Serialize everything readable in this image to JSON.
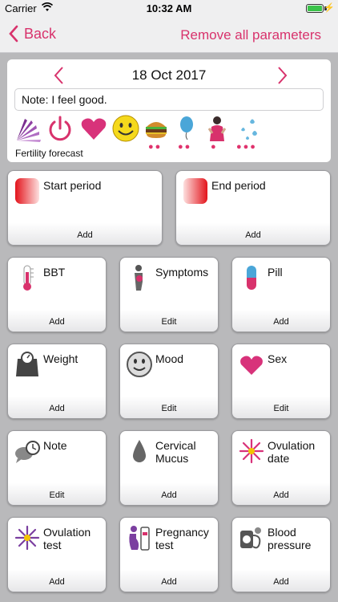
{
  "status_bar": {
    "carrier": "Carrier",
    "time": "10:32 AM"
  },
  "nav": {
    "back_label": "Back",
    "remove_label": "Remove all parameters"
  },
  "date_card": {
    "date": "18 Oct 2017",
    "note": "Note: I feel good.",
    "forecast_label": "Fertility forecast",
    "strip_icons": [
      "fertility-fan-icon",
      "power-icon",
      "heart-icon",
      "smiley-icon",
      "burger-icon",
      "balloon-icon",
      "woman-symptom-icon",
      "drops-icon"
    ]
  },
  "tiles": {
    "start_period": {
      "label": "Start period",
      "action": "Add"
    },
    "end_period": {
      "label": "End period",
      "action": "Add"
    },
    "bbt": {
      "label": "BBT",
      "action": "Add"
    },
    "symptoms": {
      "label": "Symptoms",
      "action": "Edit"
    },
    "pill": {
      "label": "Pill",
      "action": "Add"
    },
    "weight": {
      "label": "Weight",
      "action": "Add"
    },
    "mood": {
      "label": "Mood",
      "action": "Edit"
    },
    "sex": {
      "label": "Sex",
      "action": "Edit"
    },
    "note": {
      "label": "Note",
      "action": "Edit"
    },
    "cervical_mucus": {
      "label1": "Cervical",
      "label2": "Mucus",
      "action": "Add"
    },
    "ovulation_date": {
      "label1": "Ovulation",
      "label2": "date",
      "action": "Add"
    },
    "ovulation_test": {
      "label1": "Ovulation",
      "label2": "test",
      "action": "Add"
    },
    "pregnancy_test": {
      "label1": "Pregnancy",
      "label2": "test",
      "action": "Add"
    },
    "blood_pressure": {
      "label1": "Blood",
      "label2": "pressure",
      "action": "Add"
    }
  },
  "colors": {
    "accent": "#d8326c",
    "background": "#b9b9bb"
  }
}
